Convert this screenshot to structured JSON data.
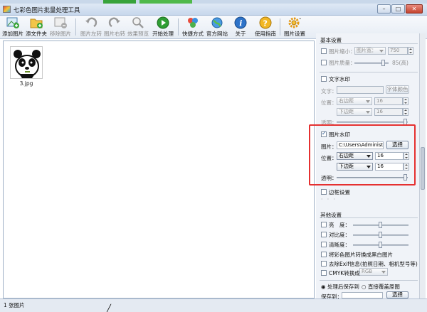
{
  "window": {
    "title": "七彩色图片批量处理工具"
  },
  "toolbar": {
    "add_image": "添加图片",
    "add_folder": "添文件夹",
    "remove_image": "移除图片",
    "rotate_left": "图片左转",
    "rotate_right": "图片右转",
    "preview": "效果预览",
    "start": "开始处理",
    "shortcut": "快捷方式",
    "website": "官方网站",
    "about": "关于",
    "help": "使用指南",
    "settings": "图片设置"
  },
  "files": [
    {
      "name": "3.jpg"
    }
  ],
  "settings": {
    "basic": {
      "header": "基本设置",
      "resize_label": "图片缩小：",
      "resize_mode": "图片宽：",
      "resize_value": "750",
      "quality_label": "图片质量：",
      "quality_value": "85(高)"
    },
    "text_watermark": {
      "header": "文字水印",
      "text_label": "文字：",
      "text_value": "",
      "font_button": "字体颜色",
      "position_label": "位置：",
      "pos_h": "右边距",
      "pos_h_value": "16",
      "pos_v": "下边距",
      "pos_v_value": "16",
      "opacity_label": "透明："
    },
    "image_watermark": {
      "header": "图片水印",
      "checked": true,
      "image_label": "图片：",
      "image_path": "C:\\Users\\Administr",
      "choose_button": "选择",
      "position_label": "位置：",
      "pos_h": "右边距",
      "pos_h_value": "16",
      "pos_v": "下边距",
      "pos_v_value": "16",
      "opacity_label": "透明："
    },
    "border": {
      "header": "边框设置"
    },
    "other": {
      "header": "其他设置",
      "brightness": "亮　度：",
      "contrast": "对比度：",
      "sharpness": "清晰度：",
      "grayscale": "将彩色图片转换成黑白图片",
      "remove_exif": "去除Exif信息(拍照日期、相机型号等)",
      "cmyk_label": "CMYK转换成：",
      "cmyk_value": "RGB"
    },
    "output": {
      "save_to": "处理后保存到",
      "overwrite": "直接覆盖原图",
      "save_path_label": "保存到：",
      "choose_button": "选择"
    }
  },
  "status": {
    "text": "1 张图片"
  }
}
